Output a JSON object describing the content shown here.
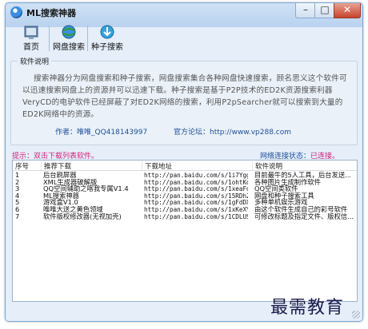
{
  "window": {
    "title": "ML搜索神器",
    "min": "–",
    "max": "□",
    "close": "✕"
  },
  "toolbar": {
    "home": "首页",
    "net_search": "网盘搜索",
    "seed_search": "种子搜索"
  },
  "description": {
    "legend": "软件说明",
    "text": "搜索神器分为网盘搜索和种子搜索，网盘搜索集合各种网盘快速搜索，顾名思义这个软件可以迅速搜索网盘上的资源并可以迅速下载。种子搜索是基于P2P技术的ED2K资源搜索利器VeryCD的电驴软件已经屏蔽了对ED2K网络的搜索，利用P2pSearcher就可以搜索到大量的ED2K网络中的资源。",
    "author_label": "作者：",
    "author": "唯唯_QQ418143997",
    "forum_label": "官方论坛：",
    "forum": "http://www.vp288.com"
  },
  "tip": "提示：双击下载列表软件。",
  "net_status": {
    "label": "网络连接状态：",
    "value": "已连接。"
  },
  "table": {
    "headers": [
      "序号",
      "推荐下载",
      "下载地址",
      "软件说明"
    ],
    "rows": [
      [
        "1",
        "后台刷屏器",
        "http://pan.baidu.com/s/1i7Yggf",
        "目前最牛的5人工具，后台发送..."
      ],
      [
        "2",
        "XML生成器破解版",
        "http://pan.baidu.com/s/1ohtKd",
        "各种图片生成制作软件"
      ],
      [
        "3",
        "QQ空间辅助之喀我专属V1.4",
        "http://pan.baidu.com/s/1xeaFd",
        "QQ空间类软件"
      ],
      [
        "4",
        "ML搜索神器",
        "http://pan.baidu.com/s/15RDh2",
        "网盘和种子搜索工具"
      ],
      [
        "5",
        "游戏盒V1.0",
        "http://pan.baidu.com/s/1gFdDX",
        "多种单机娱乐游戏"
      ],
      [
        "6",
        "唯唯大送之黄色领域",
        "http://pan.baidu.com/s/1xKeXY",
        "由这个软件生成自己的彩号软件"
      ],
      [
        "7",
        "软件版权修改器(无视加壳)",
        "http://pan.baidu.com/s/1CDLUS",
        "可修改标题及指定文件、版权信..."
      ]
    ]
  },
  "watermark": "最需教育",
  "colors": {
    "accent": "#d0227b",
    "link": "#1f4f9a",
    "frame": "#7aa7d6"
  }
}
